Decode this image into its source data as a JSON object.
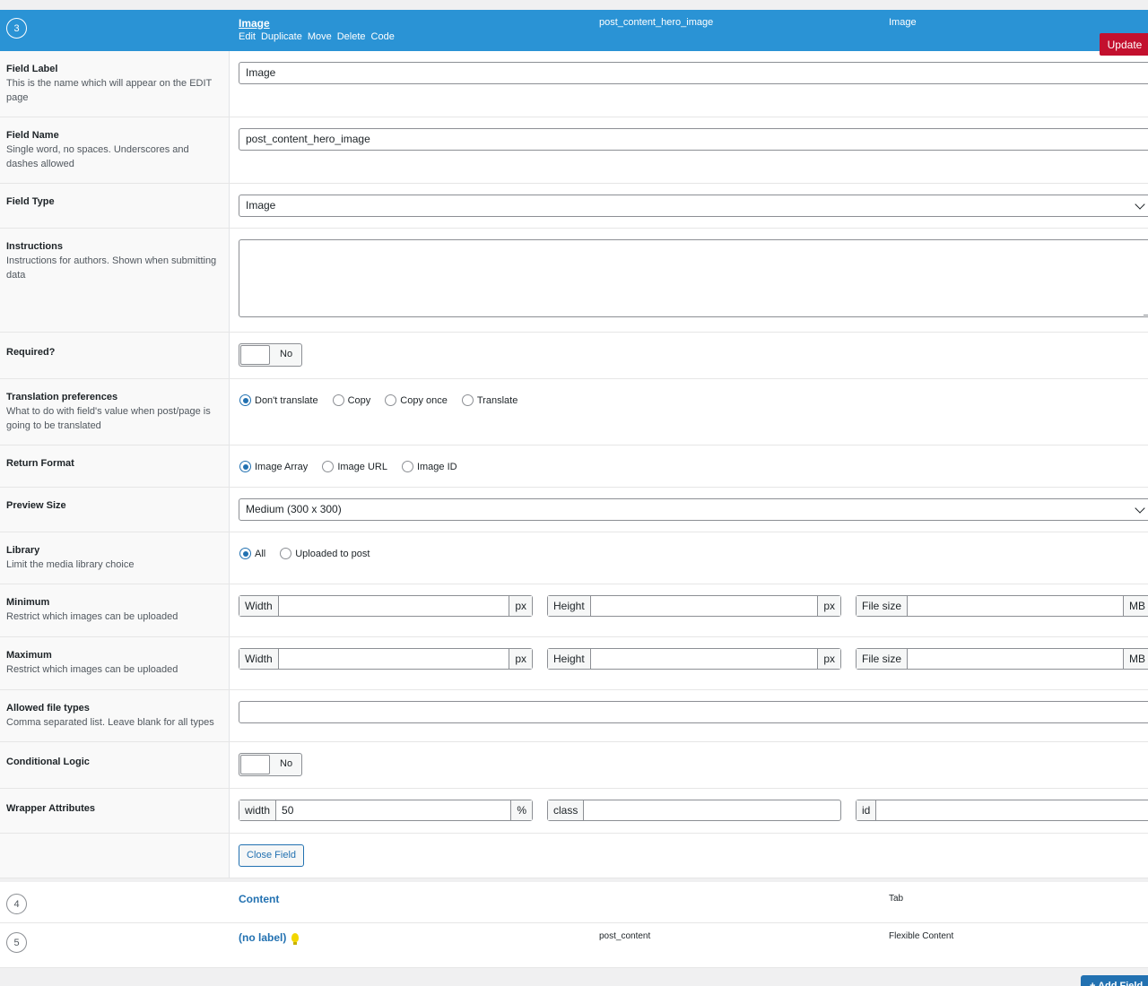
{
  "open_field": {
    "order": "3",
    "label": "Image",
    "actions": [
      "Edit",
      "Duplicate",
      "Move",
      "Delete",
      "Code"
    ],
    "name": "post_content_hero_image",
    "type": "Image",
    "update_label": "Update"
  },
  "settings": {
    "field_label": {
      "label": "Field Label",
      "desc": "This is the name which will appear on the EDIT page",
      "value": "Image"
    },
    "field_name": {
      "label": "Field Name",
      "desc": "Single word, no spaces. Underscores and dashes allowed",
      "value": "post_content_hero_image"
    },
    "field_type": {
      "label": "Field Type",
      "value": "Image"
    },
    "instructions": {
      "label": "Instructions",
      "desc": "Instructions for authors. Shown when submitting data",
      "value": ""
    },
    "required": {
      "label": "Required?",
      "toggle": "No"
    },
    "translation": {
      "label": "Translation preferences",
      "desc": "What to do with field's value when post/page is going to be translated",
      "options": [
        "Don't translate",
        "Copy",
        "Copy once",
        "Translate"
      ],
      "selected": "Don't translate"
    },
    "return_format": {
      "label": "Return Format",
      "options": [
        "Image Array",
        "Image URL",
        "Image ID"
      ],
      "selected": "Image Array"
    },
    "preview_size": {
      "label": "Preview Size",
      "value": "Medium (300 x 300)"
    },
    "library": {
      "label": "Library",
      "desc": "Limit the media library choice",
      "options": [
        "All",
        "Uploaded to post"
      ],
      "selected": "All"
    },
    "minimum": {
      "label": "Minimum",
      "desc": "Restrict which images can be uploaded",
      "width": "Width",
      "height": "Height",
      "filesize": "File size",
      "px": "px",
      "mb": "MB"
    },
    "maximum": {
      "label": "Maximum",
      "desc": "Restrict which images can be uploaded",
      "width": "Width",
      "height": "Height",
      "filesize": "File size",
      "px": "px",
      "mb": "MB"
    },
    "allowed_types": {
      "label": "Allowed file types",
      "desc": "Comma separated list. Leave blank for all types",
      "value": ""
    },
    "conditional": {
      "label": "Conditional Logic",
      "toggle": "No"
    },
    "wrapper": {
      "label": "Wrapper Attributes",
      "width_label": "width",
      "width_value": "50",
      "percent": "%",
      "class_label": "class",
      "id_label": "id"
    },
    "close_label": "Close Field"
  },
  "fields": [
    {
      "order": "4",
      "label": "Content",
      "name": "",
      "type": "Tab"
    },
    {
      "order": "5",
      "label": "(no label)",
      "name": "post_content",
      "type": "Flexible Content"
    }
  ],
  "add_field_label": "+ Add Field"
}
